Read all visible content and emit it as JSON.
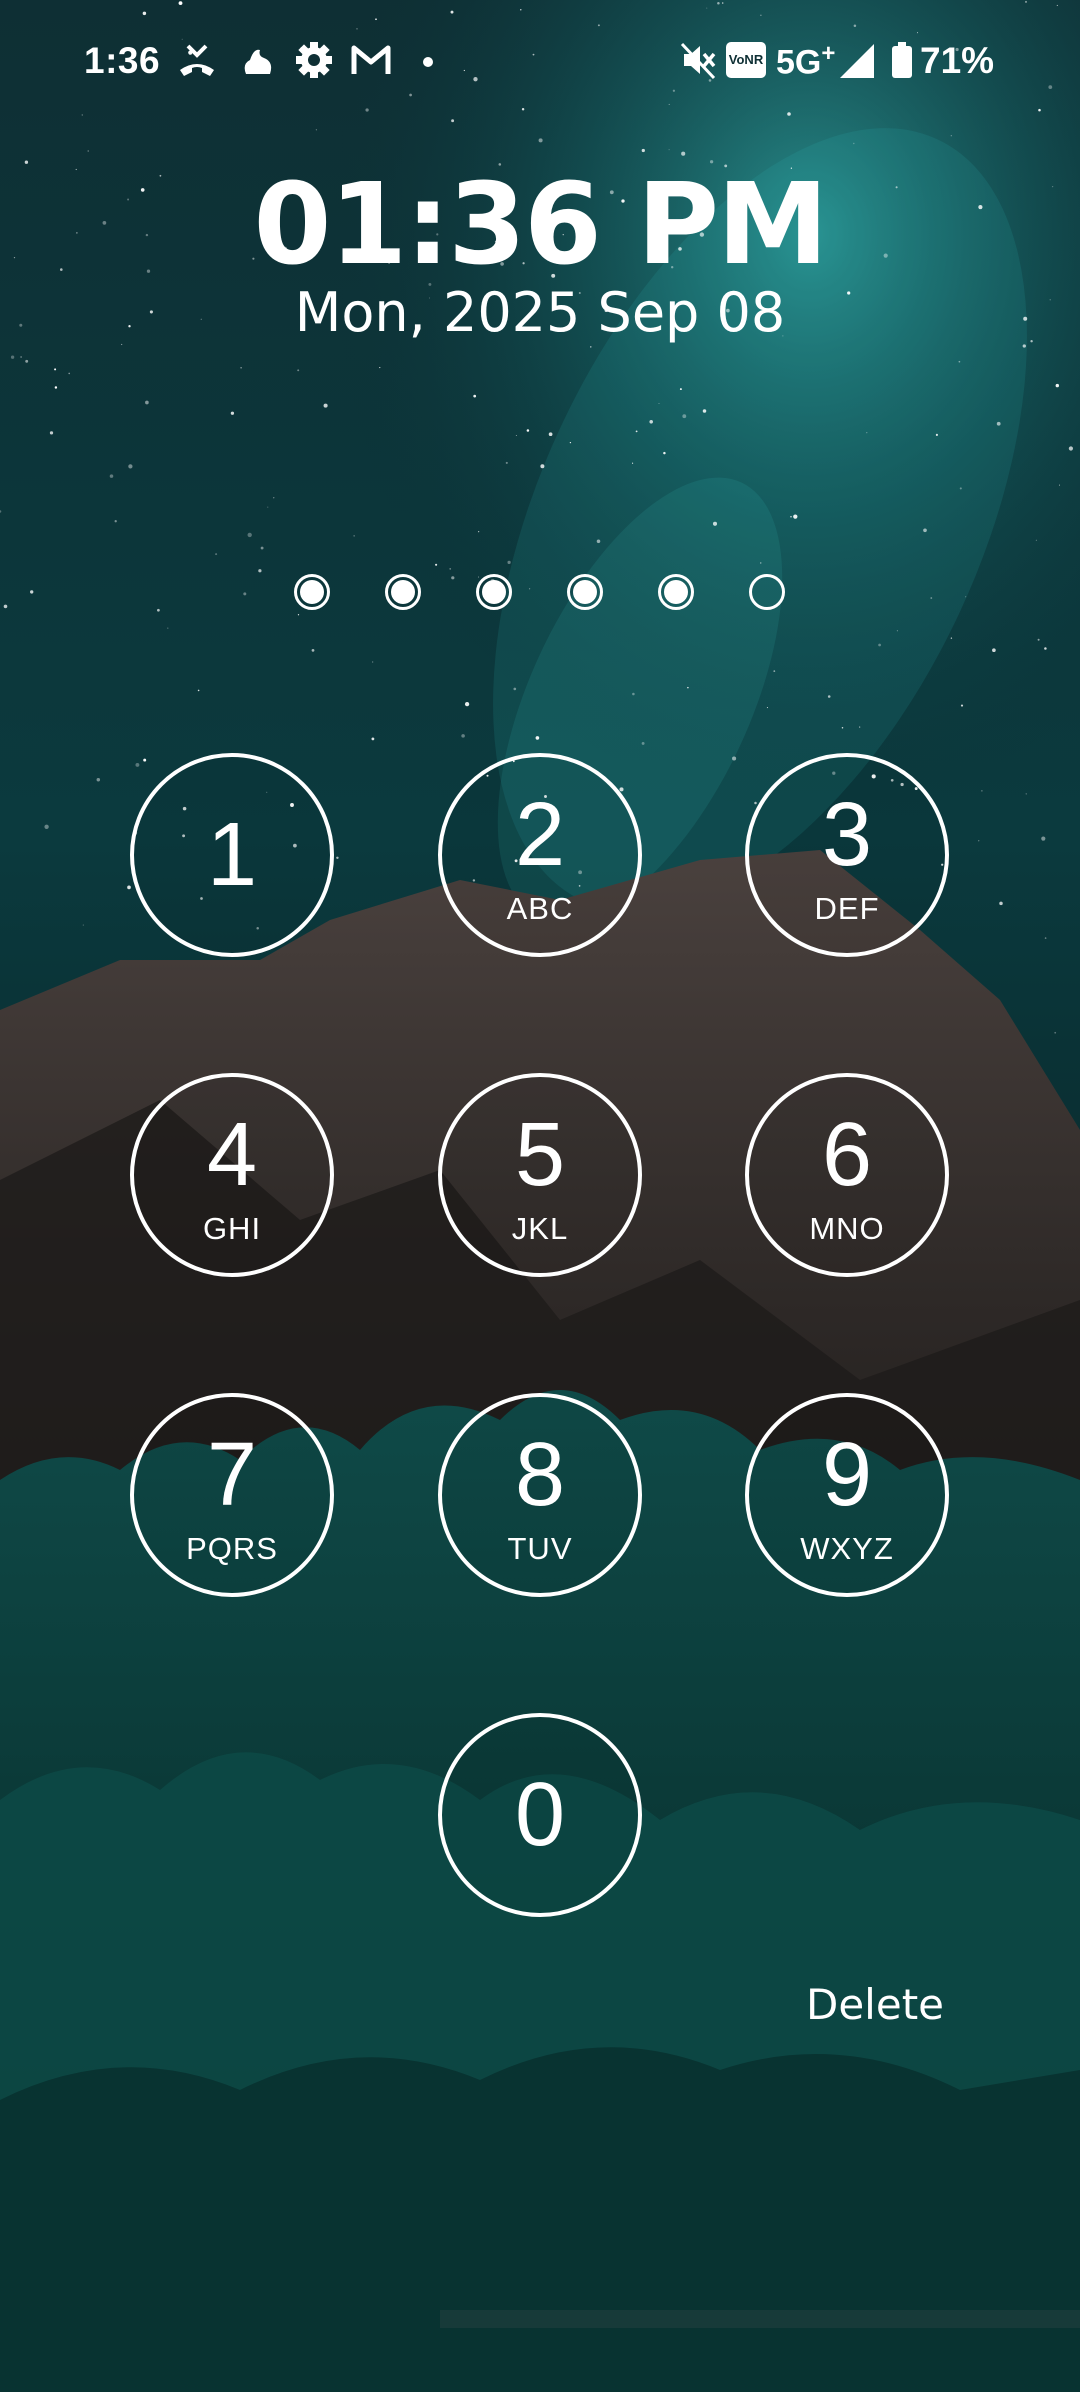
{
  "status_bar": {
    "time": "1:36",
    "icons_left": [
      "missed-call-icon",
      "notification-icon",
      "settings-gear-icon",
      "gmail-icon",
      "more-dot-icon"
    ],
    "icons_right": [
      "mute-icon",
      "vonr-icon",
      "signal-icon",
      "battery-icon"
    ],
    "vonr_label": "VoNR",
    "network": "5G",
    "network_plus": "+",
    "battery_percent": "71%"
  },
  "lock": {
    "time": "01:36 PM",
    "date": "Mon, 2025 Sep 08"
  },
  "pin": {
    "total": 6,
    "entered": 5
  },
  "keypad": {
    "keys": [
      {
        "digit": "1",
        "letters": ""
      },
      {
        "digit": "2",
        "letters": "ABC"
      },
      {
        "digit": "3",
        "letters": "DEF"
      },
      {
        "digit": "4",
        "letters": "GHI"
      },
      {
        "digit": "5",
        "letters": "JKL"
      },
      {
        "digit": "6",
        "letters": "MNO"
      },
      {
        "digit": "7",
        "letters": "PQRS"
      },
      {
        "digit": "8",
        "letters": "TUV"
      },
      {
        "digit": "9",
        "letters": "WXYZ"
      },
      {
        "digit": "0",
        "letters": ""
      }
    ],
    "delete_label": "Delete"
  },
  "colors": {
    "foreground": "#ffffff",
    "sky": "#0b2a30",
    "accent_teal": "#2fd5d0",
    "mountain": "#3a3331"
  }
}
